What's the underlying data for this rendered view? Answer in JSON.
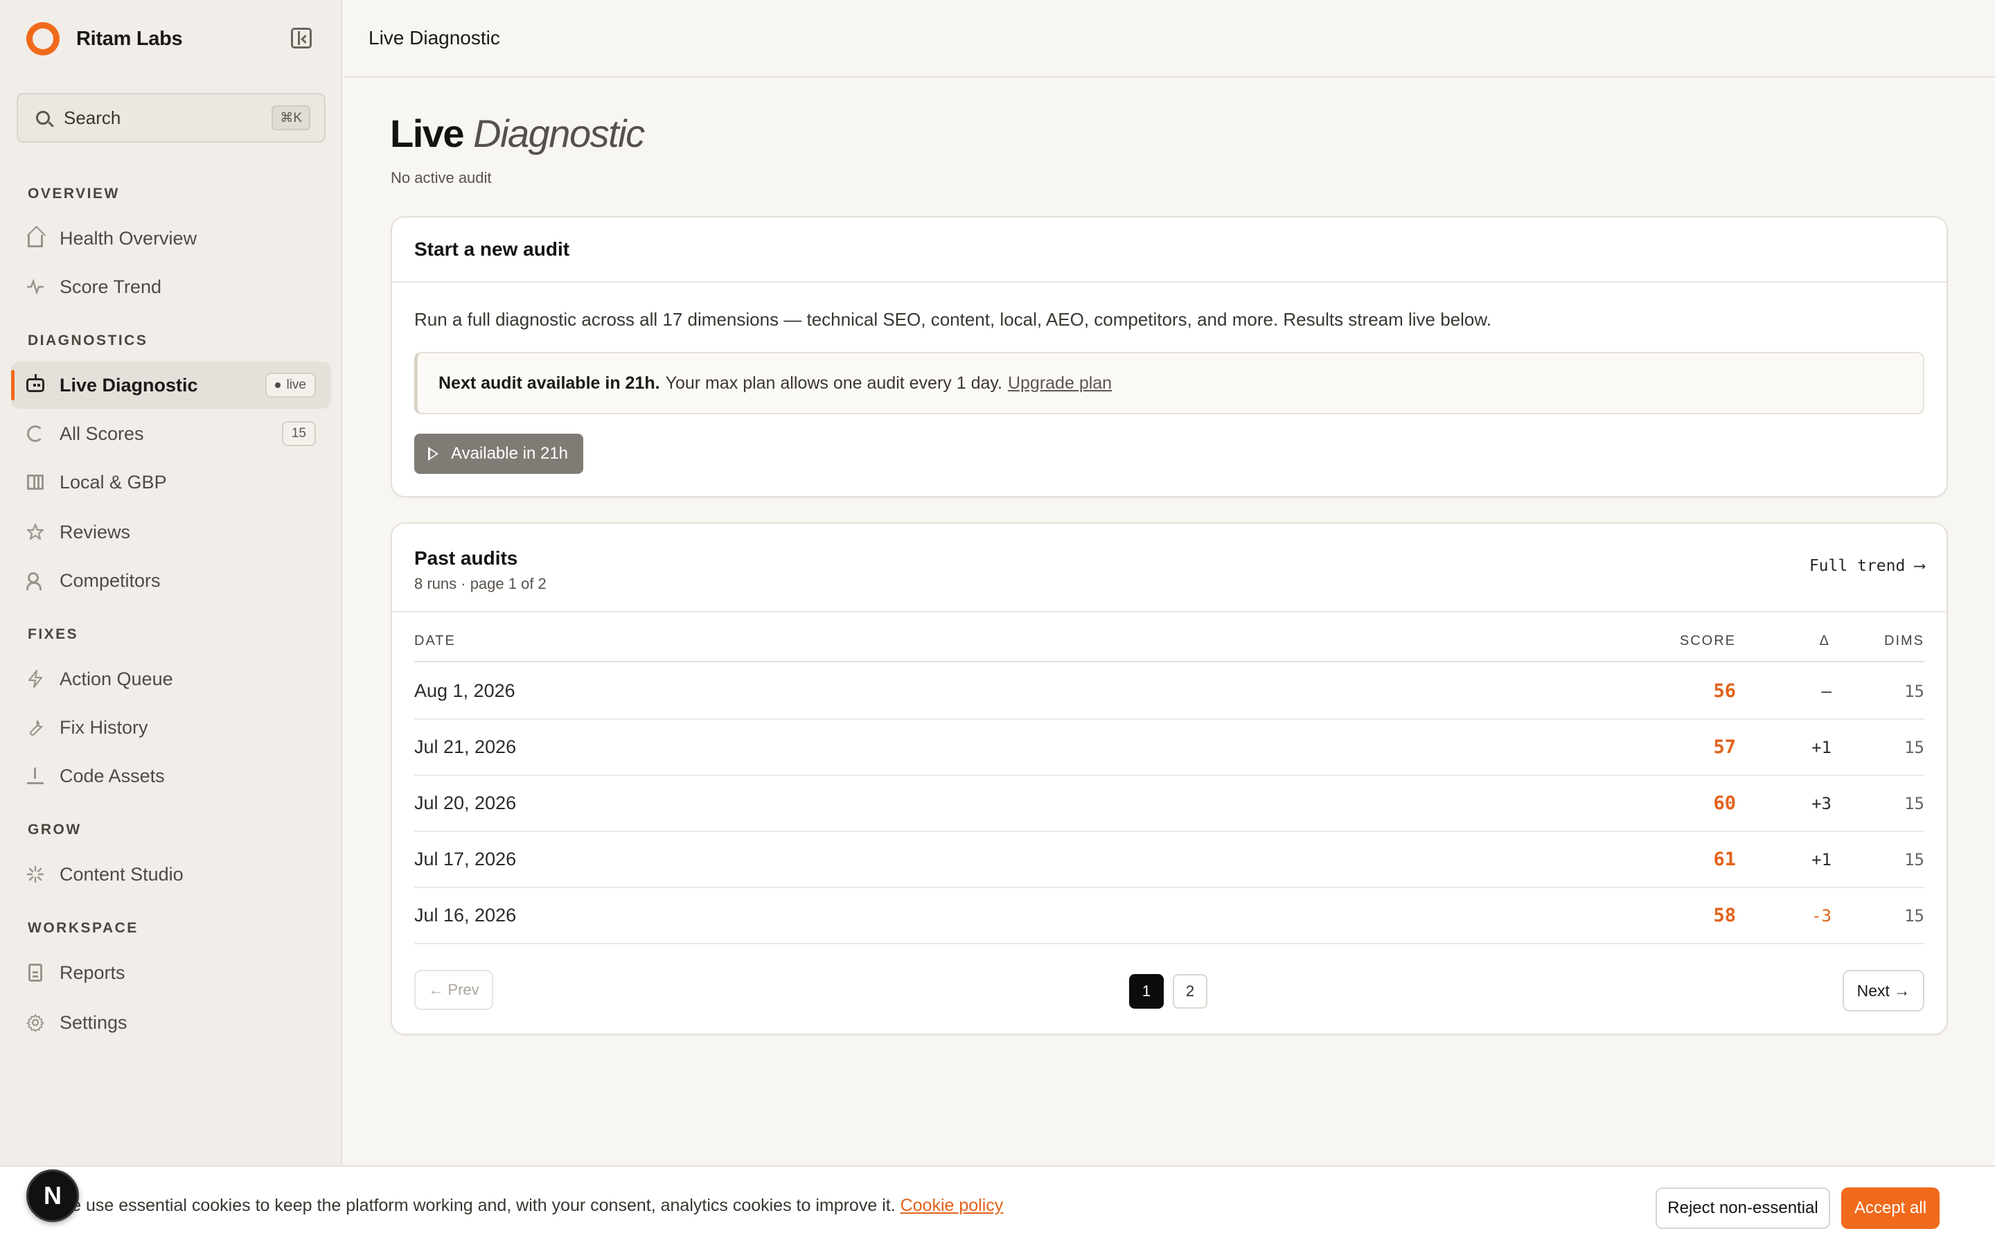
{
  "brand": {
    "name": "Ritam Labs",
    "accent": "#f06a1c"
  },
  "search": {
    "label": "Search",
    "shortcut": "⌘K"
  },
  "sidebar": {
    "sections": [
      {
        "title": "OVERVIEW"
      },
      {
        "title": "DIAGNOSTICS"
      },
      {
        "title": "FIXES"
      },
      {
        "title": "GROW"
      },
      {
        "title": "WORKSPACE"
      }
    ],
    "items": [
      {
        "label": "Health Overview",
        "icon": "home-icon"
      },
      {
        "label": "Score Trend",
        "icon": "activity-icon"
      },
      {
        "label": "Live Diagnostic",
        "icon": "bot-icon",
        "badge": "live",
        "active": true
      },
      {
        "label": "All Scores",
        "icon": "gauge-icon",
        "badge": "15"
      },
      {
        "label": "Local & GBP",
        "icon": "map-icon"
      },
      {
        "label": "Reviews",
        "icon": "star-icon"
      },
      {
        "label": "Competitors",
        "icon": "users-icon"
      },
      {
        "label": "Action Queue",
        "icon": "zap-icon"
      },
      {
        "label": "Fix History",
        "icon": "wrench-icon"
      },
      {
        "label": "Code Assets",
        "icon": "download-icon"
      },
      {
        "label": "Content Studio",
        "icon": "sparkle-icon"
      },
      {
        "label": "Reports",
        "icon": "file-icon"
      },
      {
        "label": "Settings",
        "icon": "gear-icon"
      }
    ]
  },
  "topbar": {
    "title": "Live Diagnostic"
  },
  "page": {
    "title_main": "Live",
    "title_italic": "Diagnostic",
    "subtitle": "No active audit"
  },
  "new_audit": {
    "title": "Start a new audit",
    "description": "Run a full diagnostic across all 17 dimensions — technical SEO, content, local, AEO, competitors, and more. Results stream live below.",
    "notice_bold": "Next audit available in 21h.",
    "notice_text": "Your max plan allows one audit every 1 day.",
    "notice_link": "Upgrade plan",
    "button_label": "Available in 21h"
  },
  "past_audits": {
    "title": "Past audits",
    "subtitle": "8 runs · page 1 of 2",
    "full_trend": "Full trend ⟶",
    "columns": {
      "date": "DATE",
      "score": "SCORE",
      "delta": "Δ",
      "dims": "DIMS"
    },
    "rows": [
      {
        "date": "Aug 1, 2026",
        "score": "56",
        "delta": "–",
        "dims": "15"
      },
      {
        "date": "Jul 21, 2026",
        "score": "57",
        "delta": "+1",
        "dims": "15"
      },
      {
        "date": "Jul 20, 2026",
        "score": "60",
        "delta": "+3",
        "dims": "15"
      },
      {
        "date": "Jul 17, 2026",
        "score": "61",
        "delta": "+1",
        "dims": "15"
      },
      {
        "date": "Jul 16, 2026",
        "score": "58",
        "delta": "-3",
        "dims": "15"
      }
    ],
    "pager": {
      "prev": "← Prev",
      "page1": "1",
      "page2": "2",
      "next": "Next →"
    }
  },
  "cookie": {
    "text": "We use essential cookies to keep the platform working and, with your consent, analytics cookies to improve it.",
    "link": "Cookie policy",
    "reject": "Reject non-essential",
    "accept": "Accept all"
  },
  "dev_badge": {
    "letter": "N"
  }
}
